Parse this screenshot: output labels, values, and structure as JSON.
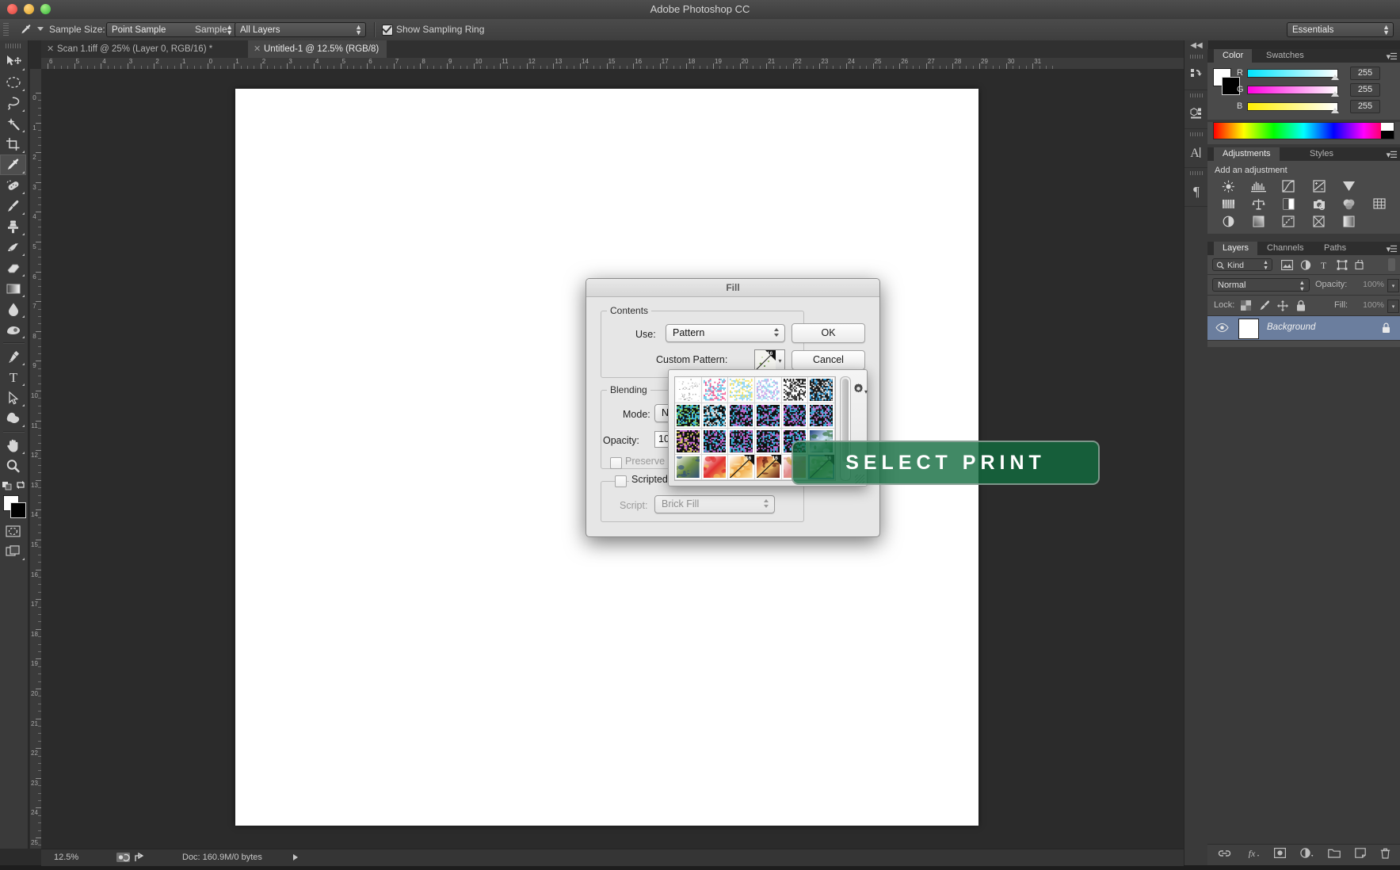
{
  "window": {
    "title": "Adobe Photoshop CC"
  },
  "options_bar": {
    "tool_icon": "eyedropper-icon",
    "sample_size_label": "Sample Size:",
    "sample_size_value": "Point Sample",
    "sample_label": "Sample:",
    "sample_value": "All Layers",
    "show_sampling_ring_label": "Show Sampling Ring",
    "show_sampling_ring_checked": true,
    "workspace_value": "Essentials"
  },
  "tabs": [
    {
      "label": "Scan 1.tiff @ 25% (Layer 0, RGB/16) *",
      "active": false
    },
    {
      "label": "Untitled-1 @ 12.5% (RGB/8)",
      "active": true
    }
  ],
  "toolbar": {
    "tools": [
      {
        "name": "move-tool",
        "icon": "move-icon",
        "selected": false
      },
      {
        "name": "elliptical-marquee-tool",
        "icon": "ellipse-marquee-icon",
        "selected": false
      },
      {
        "name": "lasso-tool",
        "icon": "lasso-icon",
        "selected": false
      },
      {
        "name": "magic-wand-tool",
        "icon": "magic-wand-icon",
        "selected": false
      },
      {
        "name": "crop-tool",
        "icon": "crop-icon",
        "selected": false
      },
      {
        "name": "eyedropper-tool",
        "icon": "eyedropper-icon",
        "selected": true
      },
      {
        "name": "healing-brush-tool",
        "icon": "healing-brush-icon",
        "selected": false
      },
      {
        "name": "brush-tool",
        "icon": "brush-icon",
        "selected": false
      },
      {
        "name": "clone-stamp-tool",
        "icon": "clone-stamp-icon",
        "selected": false
      },
      {
        "name": "history-brush-tool",
        "icon": "history-brush-icon",
        "selected": false
      },
      {
        "name": "eraser-tool",
        "icon": "eraser-icon",
        "selected": false
      },
      {
        "name": "gradient-tool",
        "icon": "gradient-icon",
        "selected": false
      },
      {
        "name": "blur-tool",
        "icon": "blur-drop-icon",
        "selected": false
      },
      {
        "name": "dodge-tool",
        "icon": "dodge-icon",
        "selected": false
      },
      {
        "name": "pen-tool",
        "icon": "pen-icon",
        "selected": false
      },
      {
        "name": "type-tool",
        "icon": "type-T-icon",
        "selected": false
      },
      {
        "name": "path-selection-tool",
        "icon": "arrow-pointer-icon",
        "selected": false
      },
      {
        "name": "custom-shape-tool",
        "icon": "shape-blob-icon",
        "selected": false
      },
      {
        "name": "hand-tool",
        "icon": "hand-icon",
        "selected": false
      },
      {
        "name": "zoom-tool",
        "icon": "magnifier-icon",
        "selected": false
      }
    ],
    "swap_colors_icon": "swap-colors-icon",
    "default_colors_icon": "default-colors-icon",
    "quick_mask_icon": "quick-mask-icon",
    "screen_mode_icon": "screen-mode-icon",
    "foreground_color": "#ffffff",
    "background_color": "#000000"
  },
  "rulers": {
    "horizontal": [
      "6",
      "5",
      "4",
      "3",
      "2",
      "1",
      "0",
      "1",
      "2",
      "3",
      "4",
      "5",
      "6",
      "7",
      "8",
      "9",
      "10",
      "11",
      "12",
      "13",
      "14",
      "15",
      "16",
      "17",
      "18",
      "19",
      "20",
      "21",
      "22",
      "23",
      "24",
      "25",
      "26",
      "27",
      "28",
      "29",
      "30",
      "31"
    ],
    "vertical": [
      "0",
      "1",
      "2",
      "3",
      "4",
      "5",
      "6",
      "7",
      "8",
      "9",
      "10",
      "11",
      "12",
      "13",
      "14",
      "15",
      "16",
      "17",
      "18",
      "19",
      "20",
      "21",
      "22",
      "23",
      "24",
      "25"
    ]
  },
  "status_bar": {
    "zoom": "12.5%",
    "doc": "Doc: 160.9M/0 bytes"
  },
  "dock_strip": {
    "collapse_icon": "double-chevron-left-icon",
    "items": [
      {
        "name": "history-panel-icon",
        "glyph": "history-icon"
      },
      {
        "name": "properties-panel-icon",
        "glyph": "properties-3d-icon"
      },
      {
        "name": "character-panel-icon",
        "glyph": "character-A-icon"
      },
      {
        "name": "paragraph-panel-icon",
        "glyph": "paragraph-pilcrow-icon"
      }
    ]
  },
  "color_panel": {
    "tabs": [
      {
        "label": "Color",
        "active": true
      },
      {
        "label": "Swatches",
        "active": false
      }
    ],
    "channels": [
      {
        "label": "R",
        "value": "255"
      },
      {
        "label": "G",
        "value": "255"
      },
      {
        "label": "B",
        "value": "255"
      }
    ]
  },
  "adjustments_panel": {
    "tabs": [
      {
        "label": "Adjustments",
        "active": true
      },
      {
        "label": "Styles",
        "active": false
      }
    ],
    "heading": "Add an adjustment",
    "icons": [
      "brightness-contrast-icon",
      "levels-icon",
      "curves-icon",
      "exposure-icon",
      "vibrance-icon",
      "",
      "hue-saturation-icon",
      "color-balance-icon",
      "black-white-icon",
      "photo-filter-icon",
      "channel-mixer-icon",
      "color-lookup-icon",
      "invert-icon",
      "posterize-icon",
      "threshold-icon",
      "selective-color-icon",
      "gradient-map-icon",
      ""
    ]
  },
  "layers_panel": {
    "tabs": [
      {
        "label": "Layers",
        "active": true
      },
      {
        "label": "Channels",
        "active": false
      },
      {
        "label": "Paths",
        "active": false
      }
    ],
    "filter_label": "Kind",
    "filter_icons": [
      "pixel-layer-filter-icon",
      "adjustment-layer-filter-icon",
      "type-layer-filter-icon",
      "shape-layer-filter-icon",
      "smart-object-filter-icon"
    ],
    "blend_mode": "Normal",
    "opacity_label": "Opacity:",
    "opacity_value": "100%",
    "lock_label": "Lock:",
    "lock_icons": [
      "lock-transparency-icon",
      "lock-image-icon",
      "lock-position-icon",
      "lock-all-icon"
    ],
    "fill_label": "Fill:",
    "fill_value": "100%",
    "layers": [
      {
        "name": "Background",
        "locked": true,
        "visible": true
      }
    ],
    "bottom_icons": [
      "link-layers-icon",
      "layer-style-fx-icon",
      "add-mask-icon",
      "new-adjustment-icon",
      "new-group-icon",
      "new-layer-icon",
      "delete-layer-icon"
    ]
  },
  "fill_dialog": {
    "title": "Fill",
    "contents_group": "Contents",
    "use_label": "Use:",
    "use_value": "Pattern",
    "custom_pattern_label": "Custom Pattern:",
    "blending_group": "Blending",
    "mode_label": "Mode:",
    "mode_value": "N",
    "opacity_label": "Opacity:",
    "opacity_value": "10",
    "preserve_label": "Preserve",
    "preserve_checked": false,
    "scripted_patterns_label": "Scripted Patterns",
    "scripted_patterns_checked": false,
    "script_label": "Script:",
    "script_value": "Brick Fill",
    "ok_label": "OK",
    "cancel_label": "Cancel"
  },
  "pattern_picker": {
    "gear_icon": "gear-icon",
    "columns": 6,
    "rows": 4,
    "selected_index": 23,
    "swatches": [
      {
        "name": "confetti-white",
        "kind": "speckle",
        "bg": "#ffffff",
        "c1": "#b9b9b9",
        "c2": "#8d8d8d",
        "badge": false
      },
      {
        "name": "pink-blue-doodle",
        "kind": "noise",
        "bg": "#ffffff",
        "c1": "#ef5f95",
        "c2": "#6ec7e8",
        "badge": false
      },
      {
        "name": "pastel-letters",
        "kind": "noise",
        "bg": "#ffffff",
        "c1": "#8fd5f2",
        "c2": "#f2e36a",
        "badge": false
      },
      {
        "name": "pastel-violet-doodle",
        "kind": "noise",
        "bg": "#ffffff",
        "c1": "#c9a5e6",
        "c2": "#9adcf0",
        "badge": false
      },
      {
        "name": "black-scatter",
        "kind": "noise",
        "bg": "#ffffff",
        "c1": "#111111",
        "c2": "#333333",
        "badge": false
      },
      {
        "name": "blue-dense-a",
        "kind": "noise",
        "bg": "#1b1b1b",
        "c1": "#3aa9e8",
        "c2": "#e9e9e9",
        "badge": false
      },
      {
        "name": "noise-cyan-1",
        "kind": "noise",
        "bg": "#101010",
        "c1": "#41c4ef",
        "c2": "#8ce36f",
        "badge": false
      },
      {
        "name": "noise-cyan-2",
        "kind": "noise",
        "bg": "#101010",
        "c1": "#41c4ef",
        "c2": "#f1f1f1",
        "badge": false
      },
      {
        "name": "noise-magenta-1",
        "kind": "noise",
        "bg": "#101010",
        "c1": "#d36fe0",
        "c2": "#41c4ef",
        "badge": false
      },
      {
        "name": "noise-magenta-2",
        "kind": "noise",
        "bg": "#101010",
        "c1": "#d36fe0",
        "c2": "#41c4ef",
        "badge": false
      },
      {
        "name": "noise-magenta-3",
        "kind": "noise",
        "bg": "#101010",
        "c1": "#cf6ade",
        "c2": "#3fb7e8",
        "badge": false
      },
      {
        "name": "noise-blue-4",
        "kind": "noise",
        "bg": "#101010",
        "c1": "#49b9ea",
        "c2": "#d083e3",
        "badge": false
      },
      {
        "name": "noise-violet-1",
        "kind": "noise",
        "bg": "#101010",
        "c1": "#d36fe0",
        "c2": "#f2e36a",
        "badge": false
      },
      {
        "name": "noise-violet-2",
        "kind": "noise",
        "bg": "#101010",
        "c1": "#d36fe0",
        "c2": "#41c4ef",
        "badge": false
      },
      {
        "name": "noise-violet-3",
        "kind": "noise",
        "bg": "#101010",
        "c1": "#cf6ade",
        "c2": "#41c4ef",
        "badge": false
      },
      {
        "name": "noise-violet-4",
        "kind": "noise",
        "bg": "#101010",
        "c1": "#d36fe0",
        "c2": "#3fb7e8",
        "badge": false
      },
      {
        "name": "noise-violet-5",
        "kind": "noise",
        "bg": "#101010",
        "c1": "#cf6ade",
        "c2": "#41c4ef",
        "badge": false
      },
      {
        "name": "winter-scene",
        "kind": "photo",
        "bg": "#1b3d7a",
        "c1": "#cfe6f7",
        "c2": "#2f6f3a",
        "badge": false
      },
      {
        "name": "landscape-strip",
        "kind": "photo",
        "bg": "#f2f2f2",
        "c1": "#6f8f45",
        "c2": "#2f4f7a",
        "badge": false
      },
      {
        "name": "red-bordered-strip",
        "kind": "photo",
        "bg": "#ffffff",
        "c1": "#e03232",
        "c2": "#f2c45a",
        "badge": false
      },
      {
        "name": "orange-swirl",
        "kind": "photo",
        "bg": "#ffffff",
        "c1": "#f0a23a",
        "c2": "#fbe6b0",
        "badge": true
      },
      {
        "name": "red-vintage-figure",
        "kind": "photo",
        "bg": "#b8241e",
        "c1": "#f0c26a",
        "c2": "#5a1410",
        "badge": true
      },
      {
        "name": "white-light-sketch",
        "kind": "photo",
        "bg": "#ffffff",
        "c1": "#e08b8b",
        "c2": "#c9a24a",
        "badge": false
      },
      {
        "name": "green-bamboo",
        "kind": "photo",
        "bg": "#f0f4ea",
        "c1": "#6fae52",
        "c2": "#cfe0bf",
        "badge": true
      }
    ]
  },
  "overlay": {
    "label": "SELECT PRINT"
  }
}
